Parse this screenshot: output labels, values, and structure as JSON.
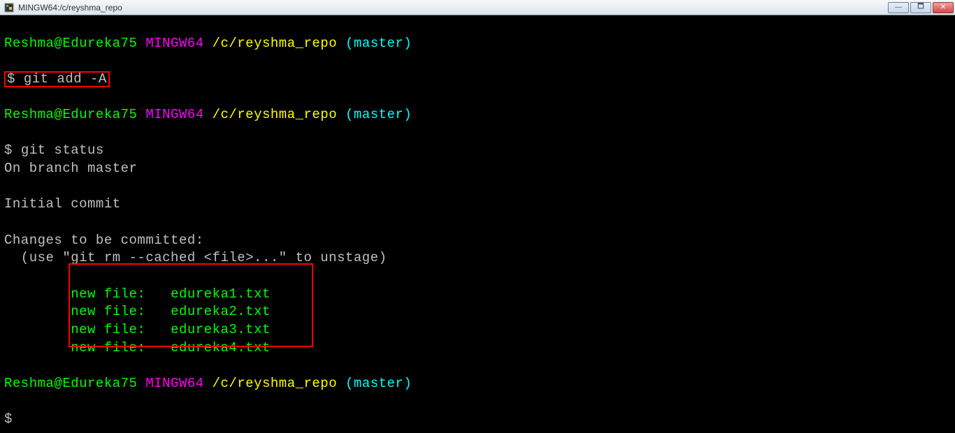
{
  "titlebar": {
    "title": "MINGW64:/c/reyshma_repo"
  },
  "controls": {
    "minimize": "—",
    "maximize": "🗖",
    "close": "✕"
  },
  "prompt1": {
    "userhost": "Reshma@Edureka75",
    "mingw": "MINGW64",
    "path": "/c/reyshma_repo",
    "branch": "(master)",
    "symbol": "$",
    "command": "git add -A"
  },
  "prompt2": {
    "userhost": "Reshma@Edureka75",
    "mingw": "MINGW64",
    "path": "/c/reyshma_repo",
    "branch": "(master)",
    "symbol": "$",
    "command": "git status"
  },
  "status": {
    "line1": "On branch master",
    "line2": "Initial commit",
    "line3": "Changes to be committed:",
    "line4": "  (use \"git rm --cached <file>...\" to unstage)"
  },
  "files": {
    "f1_label": "new file:",
    "f1_name": "edureka1.txt",
    "f2_label": "new file:",
    "f2_name": "edureka2.txt",
    "f3_label": "new file:",
    "f3_name": "edureka3.txt",
    "f4_label": "new file:",
    "f4_name": "edureka4.txt"
  },
  "prompt3": {
    "userhost": "Reshma@Edureka75",
    "mingw": "MINGW64",
    "path": "/c/reyshma_repo",
    "branch": "(master)",
    "symbol": "$"
  }
}
